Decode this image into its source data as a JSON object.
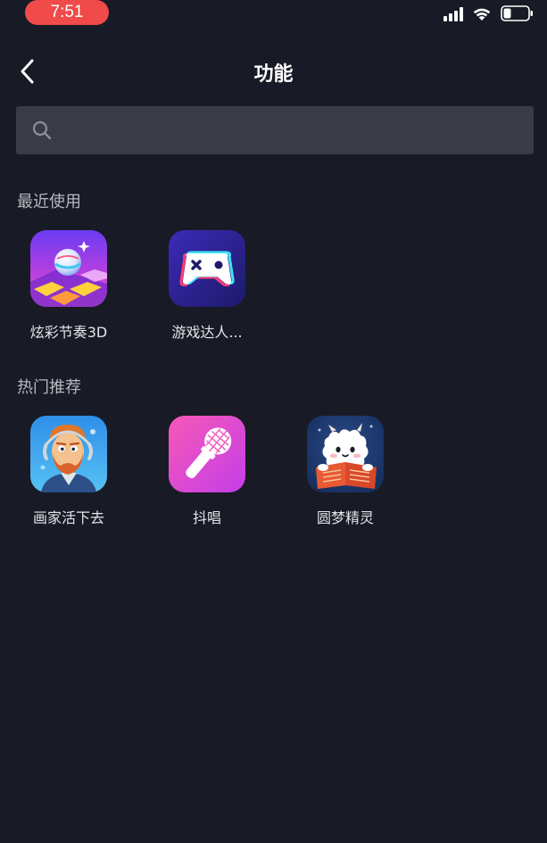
{
  "status_bar": {
    "time": "7:51",
    "time_pill_color": "#f04a4a",
    "icons": [
      "signal-icon",
      "wifi-icon",
      "battery-icon"
    ]
  },
  "header": {
    "back_icon": "chevron-left-icon",
    "title": "功能"
  },
  "search": {
    "icon": "search-icon",
    "value": "",
    "placeholder": ""
  },
  "recent": {
    "title": "最近使用",
    "apps": [
      {
        "label": "炫彩节奏3D",
        "icon": "rhythm-ball-icon"
      },
      {
        "label": "游戏达人...",
        "icon": "gamepad-icon"
      }
    ]
  },
  "hot": {
    "title": "热门推荐",
    "apps": [
      {
        "label": "画家活下去",
        "icon": "painter-portrait-icon"
      },
      {
        "label": "抖唱",
        "icon": "microphone-icon"
      },
      {
        "label": "圆梦精灵",
        "icon": "sheep-reading-icon"
      }
    ]
  },
  "colors": {
    "background": "#181a25",
    "search_background": "#3a3b46",
    "section_title": "#b8b9c0"
  }
}
